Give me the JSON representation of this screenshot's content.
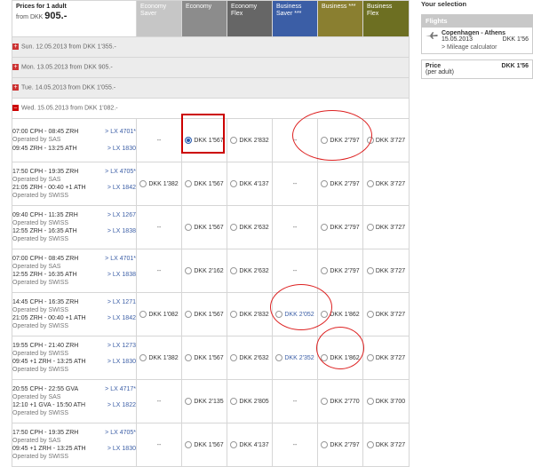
{
  "header": {
    "prices_for": "Prices for 1 adult",
    "from_prefix": "from DKK",
    "from_value": "905.-",
    "fare_classes": [
      "Economy Saver",
      "Economy",
      "Economy Flex",
      "Business Saver ***",
      "Business ***",
      "Business Flex"
    ]
  },
  "days_collapsed": [
    "Sun. 12.05.2013 from DKK 1'355.-",
    "Mon. 13.05.2013 from DKK 905.-",
    "Tue. 14.05.2013 from DKK 1'055.-"
  ],
  "day_open": "Wed. 15.05.2013 from DKK 1'082.-",
  "flights": [
    {
      "l1": "07:00 CPH - 08:45 ZRH",
      "f1": "> LX 4701*",
      "o1": "Operated by SAS",
      "l2": "09:45 ZRH - 13:25 ATH",
      "f2": "> LX 1830",
      "o2": "",
      "fares": [
        "--",
        "DKK 1'567",
        "DKK 2'832",
        "--",
        "DKK 2'797",
        "DKK 3'727"
      ]
    },
    {
      "l1": "17:50 CPH - 19:35 ZRH",
      "f1": "> LX 4705*",
      "o1": "Operated by SAS",
      "l2": "21:05 ZRH - 00:40 +1 ATH",
      "f2": "> LX 1842",
      "o2": "Operated by SWISS",
      "fares": [
        "DKK 1'382",
        "DKK 1'567",
        "DKK 4'137",
        "--",
        "DKK 2'797",
        "DKK 3'727"
      ]
    },
    {
      "l1": "09:40 CPH - 11:35 ZRH",
      "f1": "> LX 1267",
      "o1": "Operated by SWISS",
      "l2": "12:55 ZRH - 16:35 ATH",
      "f2": "> LX 1838",
      "o2": "Operated by SWISS",
      "fares": [
        "--",
        "DKK 1'567",
        "DKK 2'632",
        "--",
        "DKK 2'797",
        "DKK 3'727"
      ]
    },
    {
      "l1": "07:00 CPH - 08:45 ZRH",
      "f1": "> LX 4701*",
      "o1": "Operated by SAS",
      "l2": "12:55 ZRH - 16:35 ATH",
      "f2": "> LX 1838",
      "o2": "Operated by SWISS",
      "fares": [
        "--",
        "DKK 2'162",
        "DKK 2'632",
        "--",
        "DKK 2'797",
        "DKK 3'727"
      ]
    },
    {
      "l1": "14:45 CPH - 16:35 ZRH",
      "f1": "> LX 1271",
      "o1": "Operated by SWISS",
      "l2": "21:05 ZRH - 00:40 +1 ATH",
      "f2": "> LX 1842",
      "o2": "Operated by SWISS",
      "fares": [
        "DKK 1'082",
        "DKK 1'567",
        "DKK 2'832",
        "DKK 2'052",
        "DKK 1'862",
        "DKK 3'727"
      ]
    },
    {
      "l1": "19:55 CPH - 21:40 ZRH",
      "f1": "> LX 1273",
      "o1": "Operated by SWISS",
      "l2": "09:45 +1 ZRH - 13:25 ATH",
      "f2": "> LX 1830",
      "o2": "Operated by SWISS",
      "fares": [
        "DKK 1'382",
        "DKK 1'567",
        "DKK 2'632",
        "DKK 2'352",
        "DKK 1'862",
        "DKK 3'727"
      ]
    },
    {
      "l1": "20:55 CPH - 22:55 GVA",
      "f1": "> LX 4717*",
      "o1": "Operated by SAS",
      "l2": "12:10 +1 GVA - 15:50 ATH",
      "f2": "> LX 1822",
      "o2": "Operated by SWISS",
      "fares": [
        "--",
        "DKK 2'135",
        "DKK 2'805",
        "--",
        "DKK 2'770",
        "DKK 3'700"
      ]
    },
    {
      "l1": "17:50 CPH - 19:35 ZRH",
      "f1": "> LX 4705*",
      "o1": "Operated by SAS",
      "l2": "09:45 +1 ZRH - 13:25 ATH",
      "f2": "> LX 1830",
      "o2": "Operated by SWISS",
      "fares": [
        "--",
        "DKK 1'567",
        "DKK 4'137",
        "--",
        "DKK 2'797",
        "DKK 3'727"
      ]
    }
  ],
  "selected": {
    "row": 0,
    "col": 1
  },
  "sidebar": {
    "title": "Your selection",
    "flights_label": "Flights",
    "route": "Copenhagen - Athens",
    "date": "15.05.2013",
    "route_price": "DKK 1'56",
    "mileage": "> Mileage calculator",
    "price_label": "Price",
    "price_sub": "(per adult)",
    "price_value": "DKK 1'56"
  },
  "colors": {
    "business_saver": "#3b5ea6",
    "business": "#8a7f30",
    "business_flex": "#6d6f22",
    "annotation": "#d22"
  }
}
